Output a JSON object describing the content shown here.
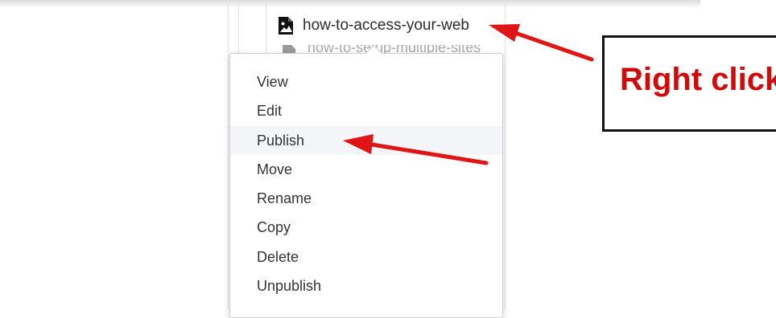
{
  "file_tree": {
    "selected_file": "how-to-access-your-web",
    "next_file_partial": "how-to-setup-multiple-sites",
    "file_icon": "image-file-icon",
    "next_icon": "document-file-icon"
  },
  "context_menu": {
    "items": [
      {
        "label": "View"
      },
      {
        "label": "Edit"
      },
      {
        "label": "Publish"
      },
      {
        "label": "Move"
      },
      {
        "label": "Rename"
      },
      {
        "label": "Copy"
      },
      {
        "label": "Delete"
      },
      {
        "label": "Unpublish"
      }
    ],
    "highlighted": "Publish"
  },
  "annotation": {
    "callout_text": "Right click",
    "arrow_color": "#e01515",
    "text_color": "#d20a0a"
  }
}
